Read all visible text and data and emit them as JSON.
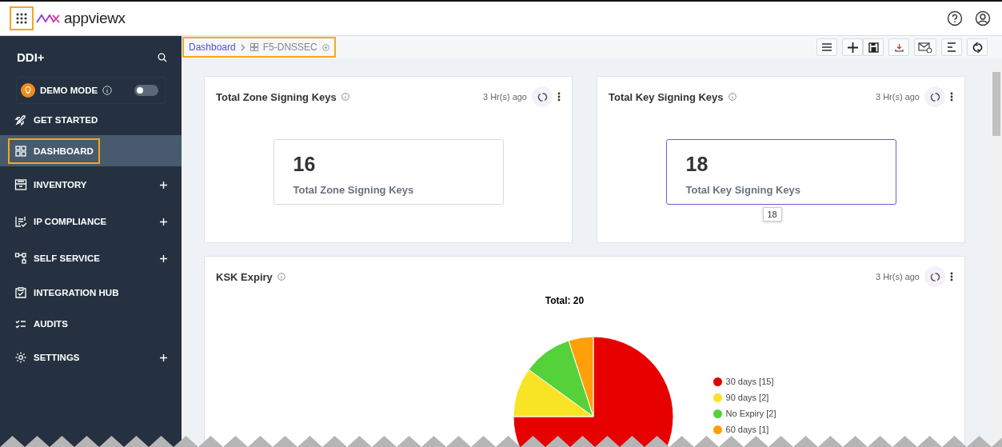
{
  "topbar": {
    "logo": "appviewx",
    "apps_highlighted": true
  },
  "sidebar": {
    "title": "DDI+",
    "demo_mode": {
      "label": "DEMO MODE",
      "on": false
    },
    "items": [
      {
        "label": "GET STARTED",
        "selected": false,
        "expandable": false,
        "highlighted": false
      },
      {
        "label": "DASHBOARD",
        "selected": true,
        "expandable": false,
        "highlighted": true
      },
      {
        "label": "INVENTORY",
        "selected": false,
        "expandable": true,
        "highlighted": false
      },
      {
        "label": "IP COMPLIANCE",
        "selected": false,
        "expandable": true,
        "highlighted": false
      },
      {
        "label": "SELF SERVICE",
        "selected": false,
        "expandable": true,
        "highlighted": false
      },
      {
        "label": "INTEGRATION HUB",
        "selected": false,
        "expandable": false,
        "highlighted": false
      },
      {
        "label": "AUDITS",
        "selected": false,
        "expandable": false,
        "highlighted": false
      },
      {
        "label": "SETTINGS",
        "selected": false,
        "expandable": true,
        "highlighted": false
      }
    ]
  },
  "breadcrumb": {
    "highlighted": true,
    "items": [
      "Dashboard",
      "F5-DNSSEC"
    ]
  },
  "stat_cards": [
    {
      "title": "Total Zone Signing Keys",
      "updated": "3 Hr(s) ago",
      "value": "16",
      "label": "Total Zone Signing Keys",
      "hovered": false
    },
    {
      "title": "Total Key Signing Keys",
      "updated": "3 Hr(s) ago",
      "value": "18",
      "label": "Total Key Signing Keys",
      "hovered": true,
      "tooltip": "18"
    }
  ],
  "ksk_card": {
    "title": "KSK Expiry",
    "updated": "3 Hr(s) ago",
    "chart_data": {
      "type": "pie",
      "title": "Total: 20",
      "categories": [
        "30 days [15]",
        "90 days [2]",
        "No Expiry [2]",
        "60 days [1]"
      ],
      "values": [
        15,
        2,
        2,
        1
      ],
      "legend": "right"
    },
    "legend": [
      {
        "color": "#e60000"
      },
      {
        "color": "#f9e325"
      },
      {
        "color": "#55d139"
      },
      {
        "color": "#ff9f0a"
      }
    ]
  }
}
